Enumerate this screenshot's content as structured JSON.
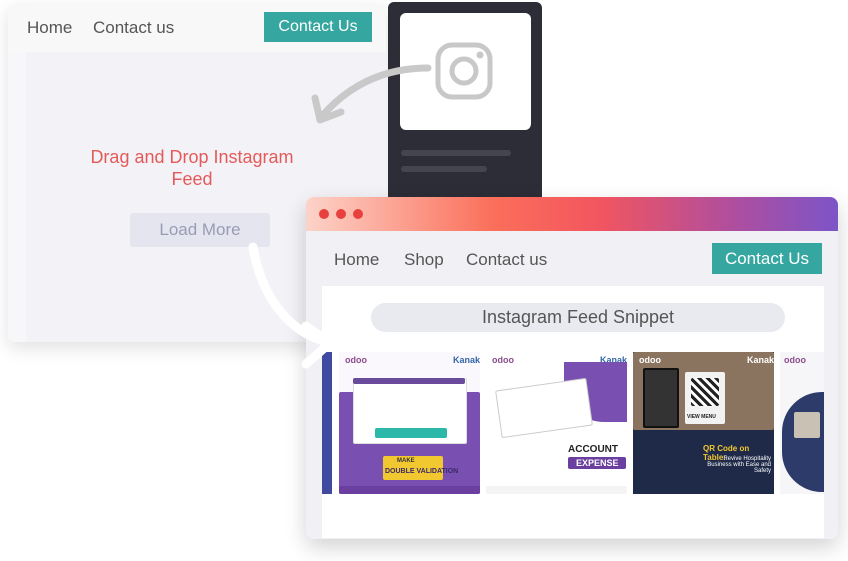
{
  "back_window": {
    "nav": {
      "home": "Home",
      "contact": "Contact us",
      "cta": "Contact Us"
    },
    "drop_text_line1": "Drag and Drop Instagram",
    "drop_text_line2": "Feed",
    "load_more": "Load More"
  },
  "snippet_panel": {
    "icon": "instagram-icon"
  },
  "front_window": {
    "nav": {
      "home": "Home",
      "shop": "Shop",
      "contact": "Contact us",
      "cta": "Contact Us"
    },
    "feed_title": "Instagram Feed Snippet",
    "tiles": [
      {
        "brand": "odoo",
        "partner": "Kanak",
        "caption_1": "MAKE",
        "caption_2": "DOUBLE VALIDATION"
      },
      {
        "brand": "odoo",
        "partner": "Kanak",
        "caption_1": "ACCOUNT",
        "caption_2": "EXPENSE"
      },
      {
        "brand": "odoo",
        "partner": "Kanak",
        "caption_0": "VIEW MENU",
        "caption_1": "QR Code on Table:",
        "caption_2": "Revive Hospitality Business with Ease and Safety"
      },
      {
        "brand": "odoo",
        "partner": ""
      }
    ]
  },
  "colors": {
    "accent": "#35a6a0",
    "drop_text": "#e45a5a",
    "panel": "#2c2d36",
    "gradient_start": "#fcd3c8",
    "gradient_end": "#7c55c8"
  }
}
